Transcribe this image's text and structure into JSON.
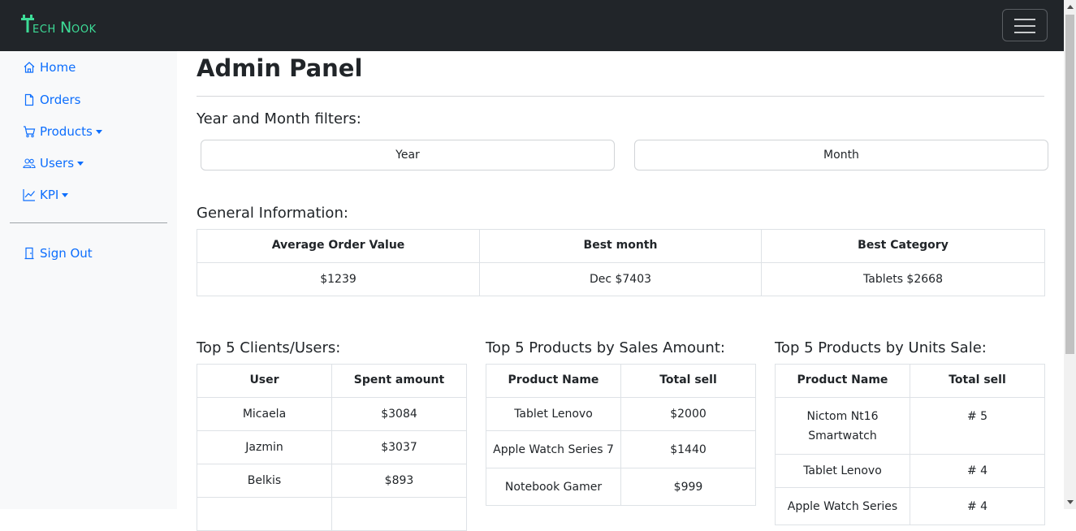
{
  "brand": {
    "first": "T",
    "rest": "ECH",
    "second": "N",
    "rest2": "OOK"
  },
  "sidebar": {
    "items": [
      {
        "label": "Home",
        "icon": "home-icon",
        "dropdown": false
      },
      {
        "label": "Orders",
        "icon": "file-icon",
        "dropdown": false
      },
      {
        "label": "Products",
        "icon": "cart-icon",
        "dropdown": true
      },
      {
        "label": "Users",
        "icon": "users-icon",
        "dropdown": true
      },
      {
        "label": "KPI",
        "icon": "chart-icon",
        "dropdown": true
      }
    ],
    "sign_out": "Sign Out"
  },
  "main": {
    "title": "Admin Panel",
    "filters_title": "Year and Month filters:",
    "year_button": "Year",
    "month_button": "Month",
    "general_title": "General Information:",
    "general": {
      "headers": [
        "Average Order Value",
        "Best month",
        "Best Category"
      ],
      "values": [
        "$1239",
        "Dec $7403",
        "Tablets $2668"
      ]
    },
    "clients": {
      "title": "Top 5 Clients/Users:",
      "headers": [
        "User",
        "Spent amount"
      ],
      "rows": [
        [
          "Micaela",
          "$3084"
        ],
        [
          "Jazmin",
          "$3037"
        ],
        [
          "Belkis",
          "$893"
        ]
      ]
    },
    "products_amount": {
      "title": "Top 5 Products by Sales Amount:",
      "headers": [
        "Product Name",
        "Total sell"
      ],
      "rows": [
        [
          "Tablet Lenovo",
          "$2000"
        ],
        [
          "Apple Watch Series 7",
          "$1440"
        ],
        [
          "Notebook Gamer",
          "$999"
        ]
      ]
    },
    "products_units": {
      "title": "Top 5 Products by Units Sale:",
      "headers": [
        "Product Name",
        "Total sell"
      ],
      "rows": [
        [
          "Nictom Nt16 Smartwatch",
          "# 5"
        ],
        [
          "Tablet Lenovo",
          "# 4"
        ],
        [
          "Apple Watch Series",
          "# 4"
        ]
      ]
    }
  },
  "colors": {
    "navbar": "#212529",
    "accent": "#0d6efd",
    "brand": "#3ddc97",
    "sidebar": "#f8f9fa"
  }
}
